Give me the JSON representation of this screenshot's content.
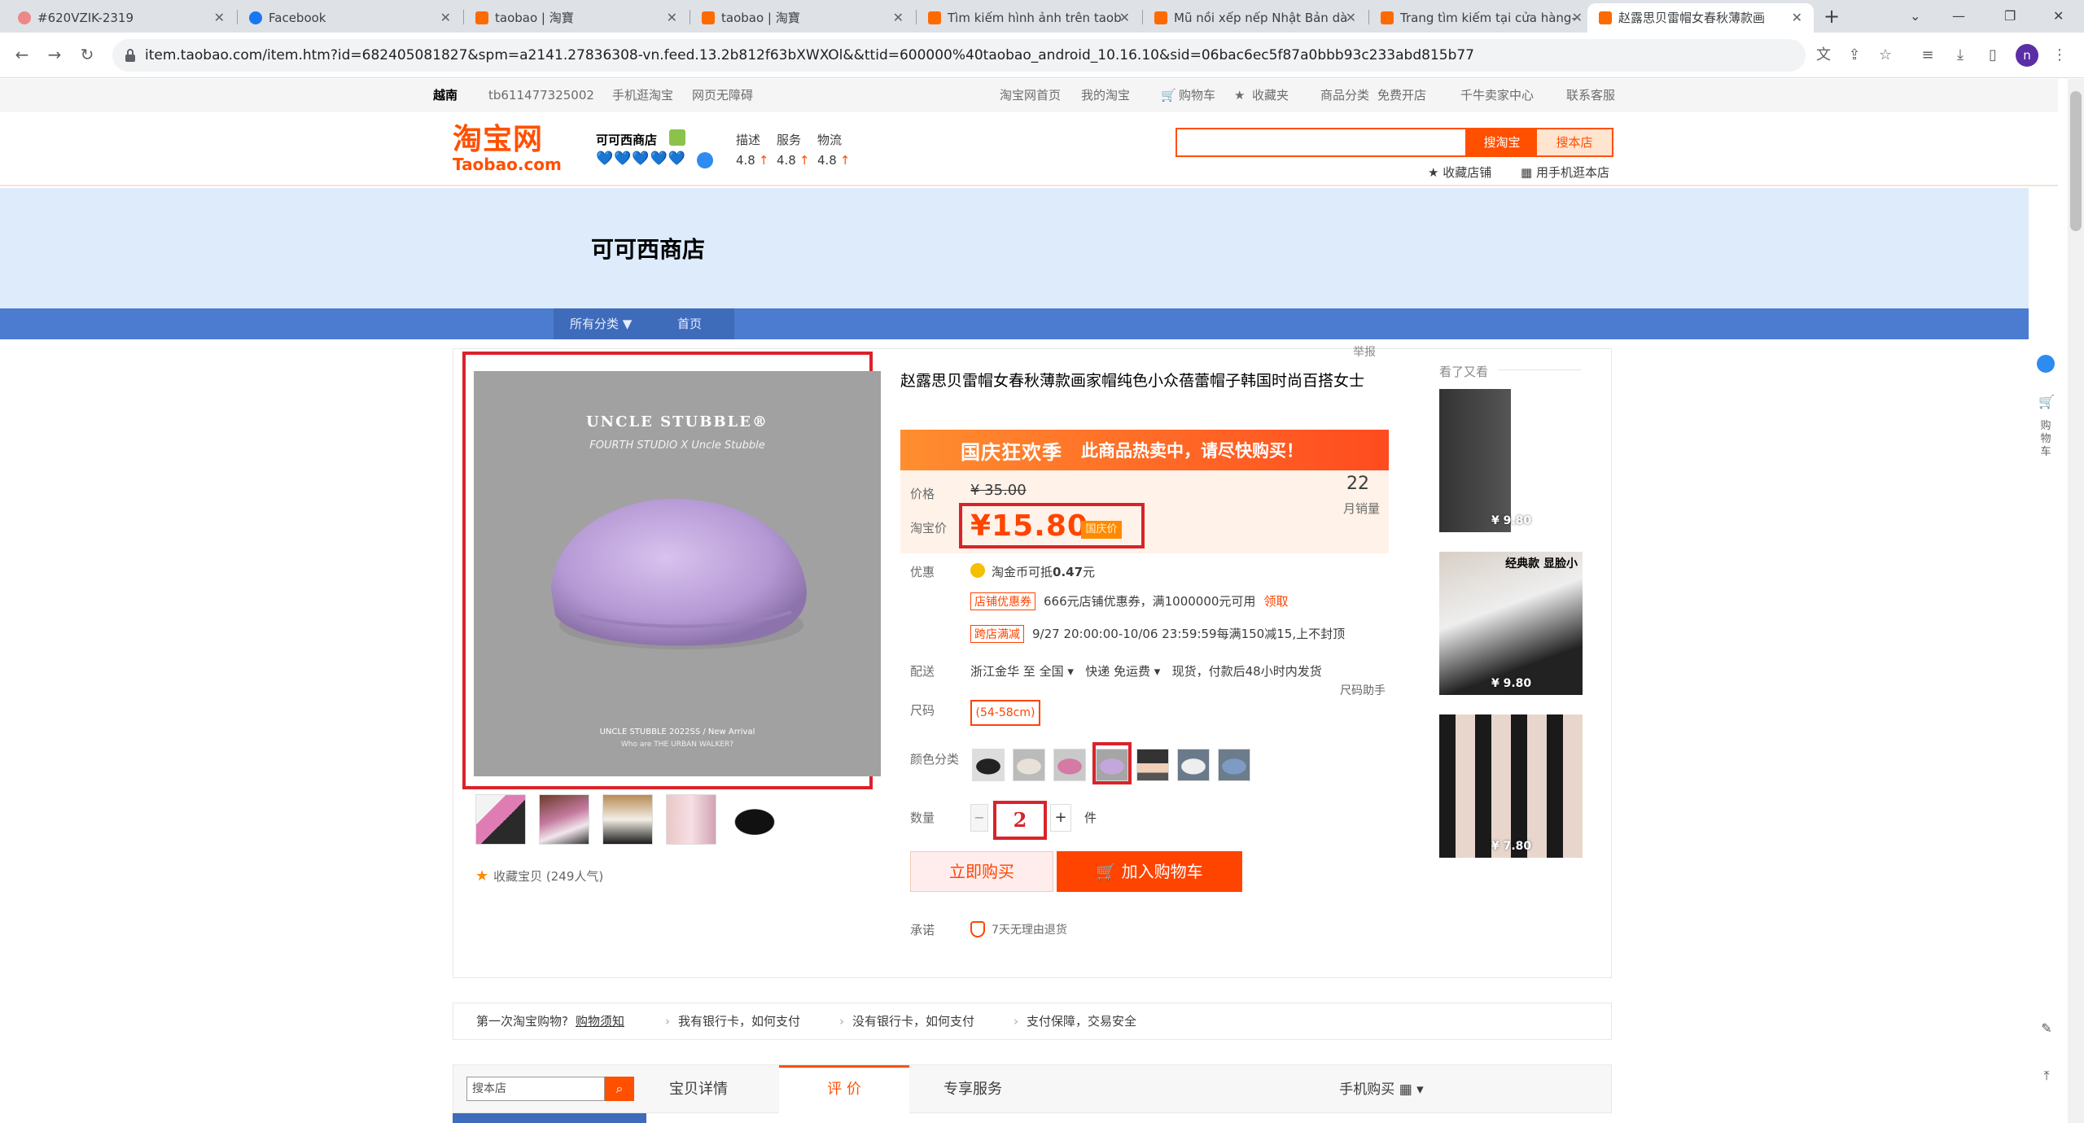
{
  "browser": {
    "tabs": [
      {
        "title": "#620VZIK-2319"
      },
      {
        "title": "Facebook"
      },
      {
        "title": "taobao | 淘寶"
      },
      {
        "title": "taobao | 淘寶"
      },
      {
        "title": "Tìm kiếm hình ảnh trên taob"
      },
      {
        "title": "Mũ nồi xếp nếp Nhật Bản dà"
      },
      {
        "title": "Trang tìm kiếm tại cửa hàng-"
      },
      {
        "title": "赵露思贝雷帽女春秋薄款画"
      }
    ],
    "url": "item.taobao.com/item.htm?id=682405081827&spm=a2141.27836308-vn.feed.13.2b812f63bXWXOl&&ttid=600000%40taobao_android_10.16.10&sid=06bac6ec5f87a0bbb93c233abd815b77",
    "profile_initial": "n"
  },
  "site_nav": {
    "region": "越南",
    "user": "tb611477325002",
    "mobile": "手机逛淘宝",
    "accessible": "网页无障碍",
    "home": "淘宝网首页",
    "my_taobao": "我的淘宝",
    "cart": "购物车",
    "favorites": "收藏夹",
    "categories": "商品分类",
    "free_open": "免费开店",
    "seller_center": "千牛卖家中心",
    "contact": "联系客服"
  },
  "header": {
    "logo_cn": "淘宝网",
    "logo_en": "Taobao.com",
    "shop_name": "可可西商店",
    "hearts": "💙💙💙💙💙",
    "scores": [
      {
        "label": "描述",
        "value": "4.8"
      },
      {
        "label": "服务",
        "value": "4.8"
      },
      {
        "label": "物流",
        "value": "4.8"
      }
    ],
    "search_taobao": "搜淘宝",
    "search_shop": "搜本店",
    "favorite_shop": "收藏店铺",
    "mobile_shop": "用手机逛本店"
  },
  "banner": {
    "shop_title": "可可西商店",
    "all_categories": "所有分类 ▼",
    "home": "首页"
  },
  "gallery": {
    "report": "举报",
    "brand_line1": "UNCLE STUBBLE®",
    "brand_line2": "FOURTH STUDIO  X  Uncle Stubble",
    "footer_line1": "UNCLE STUBBLE 2022SS / New Arrival",
    "footer_line2": "Who are THE URBAN WALKER?",
    "collect": "收藏宝贝 (249人气)"
  },
  "product": {
    "title": "赵露思贝雷帽女春秋薄款画家帽纯色小众蓓蕾帽子韩国时尚百搭女士",
    "promo_a": "国庆狂欢季",
    "promo_b": "此商品热卖中，请尽快购买！",
    "price_label": "价格",
    "old_price": "¥ 35.00",
    "sold_count": "22",
    "sold_label": "月销量",
    "taobao_price_label": "淘宝价",
    "price": "¥15.80",
    "price_tag": "国庆价",
    "discount_label": "优惠",
    "coin_text": "淘金币可抵",
    "coin_value": "0.47",
    "coin_unit": "元",
    "coupon_tag": "店铺优惠券",
    "coupon_text": "666元店铺优惠券，满1000000元可用",
    "coupon_get": "领取",
    "cross_tag": "跨店满减",
    "cross_text": "9/27 20:00:00-10/06 23:59:59每满150减15,上不封顶",
    "delivery_label": "配送",
    "delivery_from": "浙江金华 至",
    "delivery_to": "全国",
    "delivery_type": "快递 免运费",
    "delivery_note": "现货，付款后48小时内发货",
    "size_help": "尺码助手",
    "size_label": "尺码",
    "size_option": "(54-58cm)",
    "color_label": "颜色分类",
    "qty_label": "数量",
    "qty_minus": "−",
    "qty_value": "2",
    "qty_plus": "+",
    "qty_unit": "件",
    "buy_now": "立即购买",
    "add_to_cart": "加入购物车",
    "promise_label": "承诺",
    "promise_text": "7天无理由退货"
  },
  "sidebar": {
    "title": "看了又看",
    "items": [
      {
        "price": "¥ 9.80"
      },
      {
        "price": "¥ 9.80",
        "caption": "经典款 显脸小"
      },
      {
        "price": "¥ 7.80"
      }
    ]
  },
  "notice": {
    "first_time": "第一次淘宝购物?",
    "guide": "购物须知",
    "bank_card": "我有银行卡，如何支付",
    "no_bank_card": "没有银行卡，如何支付",
    "security": "支付保障，交易安全"
  },
  "detail_tabs": {
    "search_placeholder": "搜本店",
    "tabs": [
      {
        "label": "宝贝详情"
      },
      {
        "label": "评  价"
      },
      {
        "label": "专享服务"
      }
    ],
    "mobile_buy": "手机购买 ▦ ▾"
  },
  "right_tools": {
    "cart": "购物车"
  }
}
